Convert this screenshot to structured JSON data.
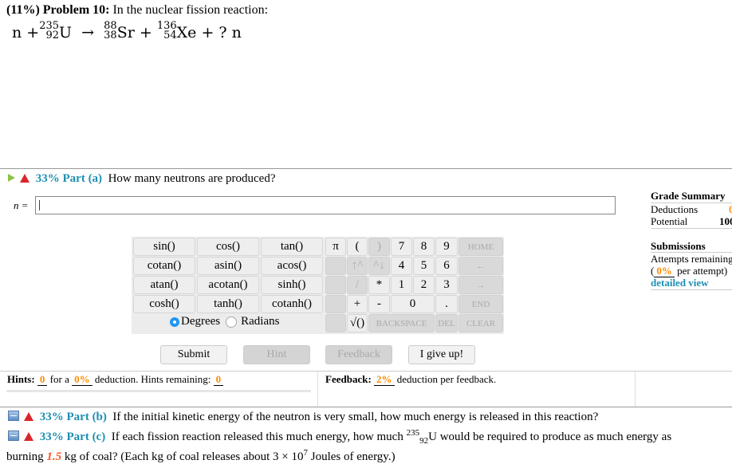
{
  "problem": {
    "weight": "(11%)",
    "label": "Problem 10:",
    "text": "In the nuclear fission reaction:",
    "equation": {
      "n": "n +",
      "u_mass": "235",
      "u_z": "92",
      "u": "U",
      "arrow": "→",
      "sr_mass": "88",
      "sr_z": "38",
      "sr": "Sr +",
      "xe_mass": "136",
      "xe_z": "54",
      "xe": "Xe + ? n"
    }
  },
  "part_a": {
    "percent": "33%",
    "label": "Part (a)",
    "question": "How many neutrons are produced?",
    "input_label": "n =",
    "input_value": ""
  },
  "grade_summary": {
    "title": "Grade Summary",
    "deductions_label": "Deductions",
    "deductions_value": "0",
    "potential_label": "Potential",
    "potential_value": "100",
    "submissions_title": "Submissions",
    "attempts_label": "Attempts remaining",
    "per_attempt_value": "0%",
    "per_attempt_text": "per attempt)",
    "detailed_view": "detailed view"
  },
  "keypad": {
    "functions": [
      "sin()",
      "cos()",
      "tan()",
      "cotan()",
      "asin()",
      "acos()",
      "atan()",
      "acotan()",
      "sinh()",
      "cosh()",
      "tanh()",
      "cotanh()"
    ],
    "degrees": "Degrees",
    "radians": "Radians",
    "angle_mode": "Degrees",
    "keys": {
      "pi": "π",
      "lparen": "(",
      "rparen": ")",
      "k7": "7",
      "k8": "8",
      "k9": "9",
      "home": "HOME",
      "up": "↑^",
      "down": "^↓",
      "k4": "4",
      "k5": "5",
      "k6": "6",
      "left": "←",
      "div": "/",
      "mul": "*",
      "k1": "1",
      "k2": "2",
      "k3": "3",
      "right": "→",
      "plus": "+",
      "minus": "-",
      "k0": "0",
      "dot": ".",
      "end": "END",
      "sqrt": "√()",
      "backspace": "BACKSPACE",
      "del": "DEL",
      "clear": "CLEAR"
    }
  },
  "buttons": {
    "submit": "Submit",
    "hint": "Hint",
    "feedback": "Feedback",
    "give_up": "I give up!"
  },
  "hints": {
    "label": "Hints:",
    "count": "0",
    "for_a": "for a",
    "deduction": "0%",
    "text": "deduction. Hints remaining:",
    "remaining": "0"
  },
  "feedback": {
    "label": "Feedback:",
    "deduction": "2%",
    "text": "deduction per feedback."
  },
  "part_b": {
    "percent": "33%",
    "label": "Part (b)",
    "question": "If the initial kinetic energy of the neutron is very small, how much energy is released in this reaction?"
  },
  "part_c": {
    "percent": "33%",
    "label": "Part (c)",
    "q1": "If each fission reaction released this much energy, how much",
    "mass": "235",
    "z": "92",
    "el": "U",
    "q2": "would be required to produce as much energy as",
    "q3": "burning",
    "coal": "1.5",
    "q4": "kg of coal? (Each kg of coal releases about 3 × 10",
    "exp": "7",
    "q5": "Joules of energy.)"
  }
}
